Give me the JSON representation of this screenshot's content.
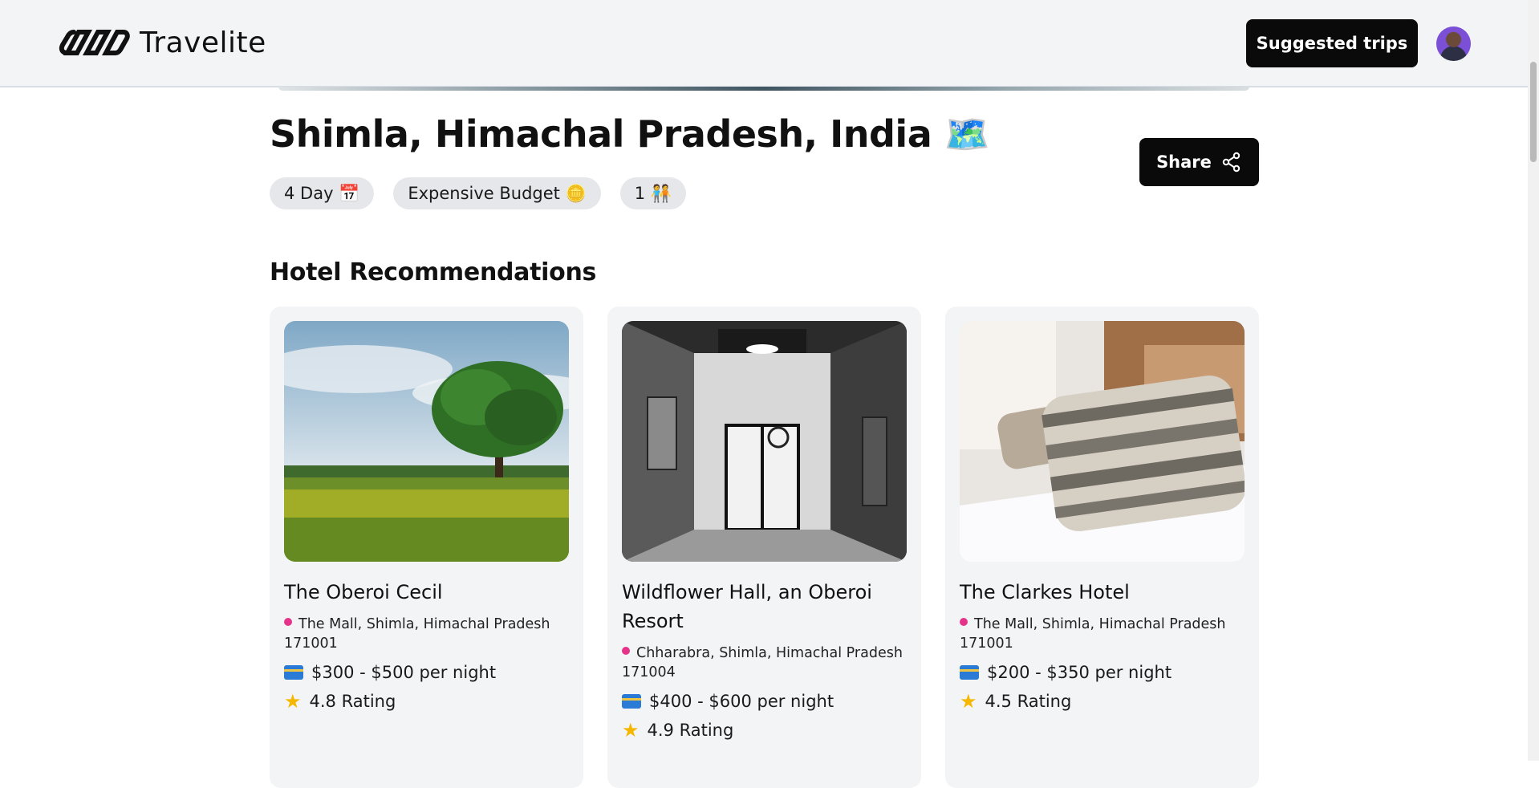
{
  "header": {
    "app_name": "Travelite",
    "suggested_label": "Suggested trips"
  },
  "trip": {
    "title": "Shimla, Himachal Pradesh, India 🗺️",
    "chips": [
      {
        "label": "4 Day 📅"
      },
      {
        "label": "Expensive Budget 🪙"
      },
      {
        "label": "1 🧑‍🤝‍🧑"
      }
    ],
    "share_label": "Share"
  },
  "hotels": {
    "section_title": "Hotel Recommendations",
    "items": [
      {
        "name": "The Oberoi Cecil",
        "address": "The Mall, Shimla, Himachal Pradesh 171001",
        "price": "$300 - $500 per night",
        "rating": "4.8 Rating"
      },
      {
        "name": "Wildflower Hall, an Oberoi Resort",
        "address": "Chharabra, Shimla, Himachal Pradesh 171004",
        "price": "$400 - $600 per night",
        "rating": "4.9 Rating"
      },
      {
        "name": "The Clarkes Hotel",
        "address": "The Mall, Shimla, Himachal Pradesh 171001",
        "price": "$200 - $350 per night",
        "rating": "4.5 Rating"
      }
    ]
  }
}
